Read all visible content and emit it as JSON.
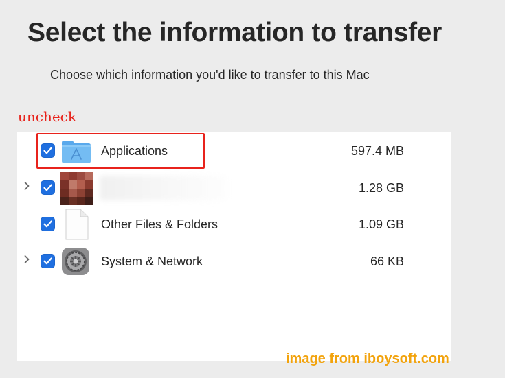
{
  "header": {
    "title": "Select the information to transfer",
    "subtitle": "Choose which information you'd like to transfer to this Mac"
  },
  "annotation": {
    "text": "uncheck",
    "color": "#e8231c"
  },
  "items": [
    {
      "label": "Applications",
      "size": "597.4 MB",
      "checked": true,
      "expandable": false,
      "icon": "applications-folder-icon"
    },
    {
      "label": "",
      "size": "1.28 GB",
      "checked": true,
      "expandable": true,
      "icon": "user-avatar-icon"
    },
    {
      "label": "Other Files & Folders",
      "size": "1.09 GB",
      "checked": true,
      "expandable": false,
      "icon": "document-icon"
    },
    {
      "label": "System & Network",
      "size": "66 KB",
      "checked": true,
      "expandable": true,
      "icon": "system-preferences-gear-icon"
    }
  ],
  "watermark": "image from iboysoft.com",
  "colors": {
    "accent": "#1f6fe0",
    "background": "#ececec",
    "panel": "#ffffff",
    "highlight": "#e8231c",
    "watermark": "#f2a30d"
  }
}
